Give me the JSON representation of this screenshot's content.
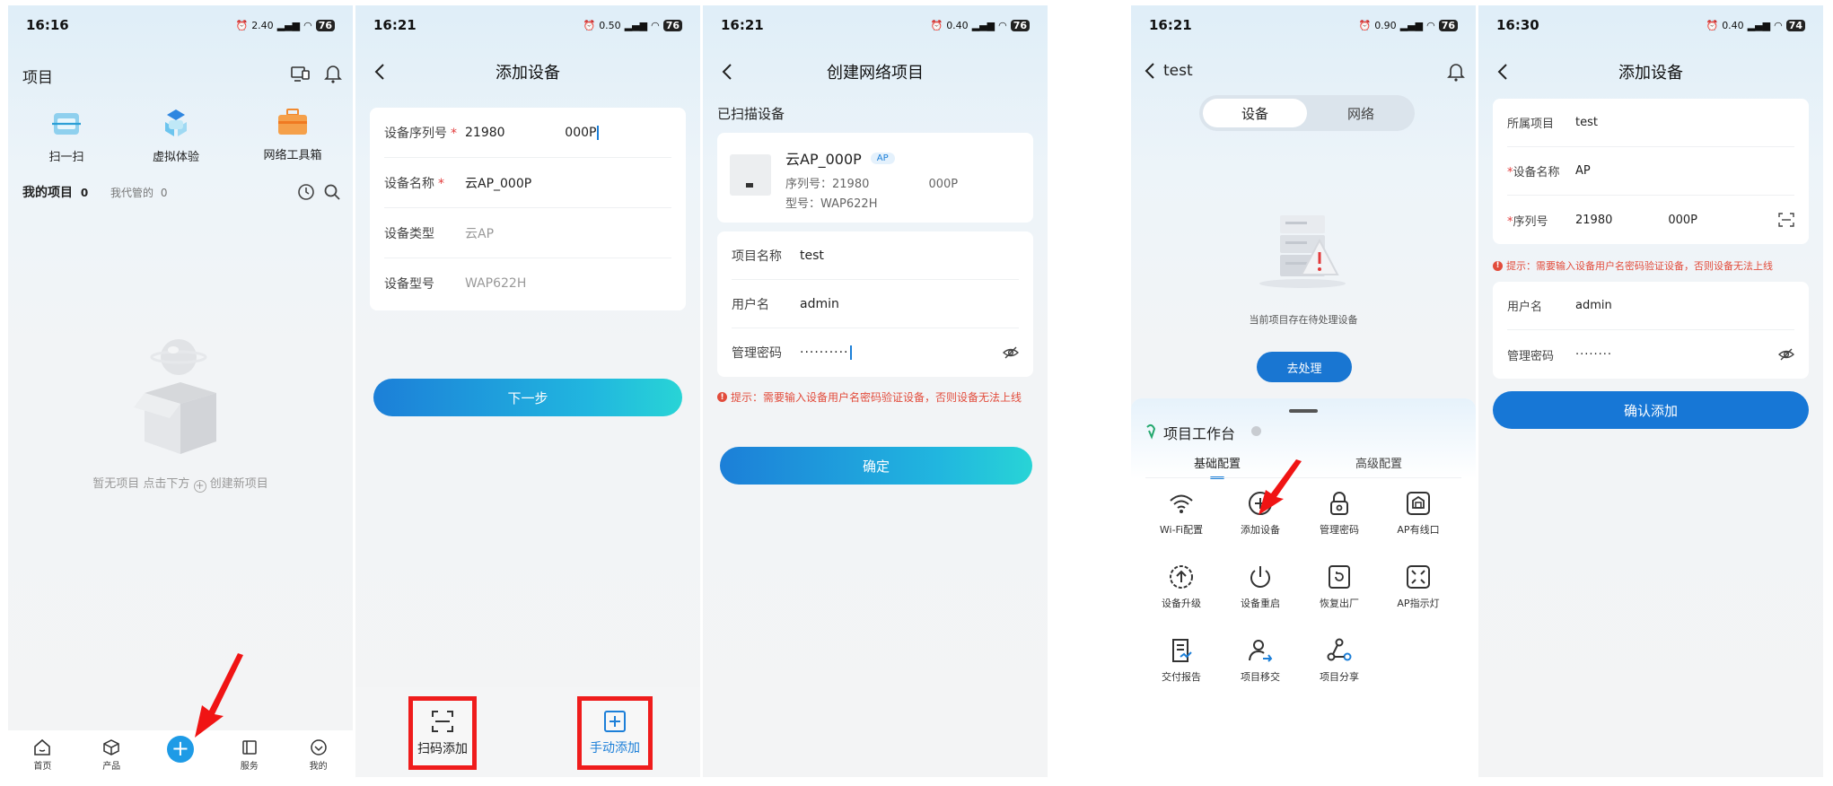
{
  "accent": "#1c7fd8",
  "warning_color": "#e24c3c",
  "screen1": {
    "time": "16:16",
    "net": "2.40",
    "battery": "76",
    "title": "项目",
    "quick_actions": [
      {
        "label": "扫一扫",
        "icon": "scan-icon"
      },
      {
        "label": "虚拟体验",
        "icon": "virtual-experience-icon"
      },
      {
        "label": "网络工具箱",
        "icon": "toolbox-icon"
      }
    ],
    "my_projects_label": "我的项目",
    "my_projects_count": "0",
    "managed_label": "我代管的",
    "managed_count": "0",
    "empty_text_a": "暂无项目 点击下方",
    "empty_text_b": "创建新项目",
    "tabs": [
      "首页",
      "产品",
      "服务",
      "我的"
    ]
  },
  "screen2": {
    "time": "16:21",
    "net": "0.50",
    "battery": "76",
    "title": "添加设备",
    "rows": [
      {
        "label": "设备序列号",
        "required": "*",
        "value": "21980               000P"
      },
      {
        "label": "设备名称",
        "required": "*",
        "value": "云AP_000P"
      },
      {
        "label": "设备类型",
        "required": "",
        "value": "云AP"
      },
      {
        "label": "设备型号",
        "required": "",
        "value": "WAP622H"
      }
    ],
    "next_button": "下一步",
    "scan_add": "扫码添加",
    "manual_add": "手动添加"
  },
  "screen3": {
    "time": "16:21",
    "net": "0.40",
    "battery": "76",
    "title": "创建网络项目",
    "scanned_label": "已扫描设备",
    "device_name": "云AP_000P",
    "device_tag": "AP",
    "serial_label": "序列号：",
    "serial_value": "21980                000P",
    "model_label": "型号：",
    "model_value": "WAP622H",
    "rows": [
      {
        "label": "项目名称",
        "value": "test"
      },
      {
        "label": "用户名",
        "value": "admin"
      },
      {
        "label": "管理密码",
        "value": "··········"
      }
    ],
    "warning": "提示：需要输入设备用户名密码验证设备，否则设备无法上线",
    "confirm": "确定"
  },
  "screen4": {
    "time": "16:21",
    "net": "0.90",
    "battery": "76",
    "back_title": "test",
    "seg_device": "设备",
    "seg_network": "网络",
    "pending_text": "当前项目存在待处理设备",
    "process_button": "去处理",
    "workbench_title": "项目工作台",
    "tab_basic": "基础配置",
    "tab_advanced": "高级配置",
    "grid": [
      {
        "label": "Wi-Fi配置",
        "icon": "wifi-icon"
      },
      {
        "label": "添加设备",
        "icon": "add-device-icon"
      },
      {
        "label": "管理密码",
        "icon": "lock-icon"
      },
      {
        "label": "AP有线口",
        "icon": "ap-port-icon"
      },
      {
        "label": "设备升级",
        "icon": "upgrade-icon"
      },
      {
        "label": "设备重启",
        "icon": "power-icon"
      },
      {
        "label": "恢复出厂",
        "icon": "reset-icon"
      },
      {
        "label": "AP指示灯",
        "icon": "ap-light-icon"
      },
      {
        "label": "交付报告",
        "icon": "report-icon"
      },
      {
        "label": "项目移交",
        "icon": "transfer-icon"
      },
      {
        "label": "项目分享",
        "icon": "share-icon"
      }
    ]
  },
  "screen5": {
    "time": "16:30",
    "net": "0.40",
    "battery": "74",
    "title": "添加设备",
    "rows": [
      {
        "label": "所属项目",
        "required": "",
        "value": "test"
      },
      {
        "label": "设备名称",
        "required": "*",
        "value": "AP"
      },
      {
        "label": "序列号",
        "required": "*",
        "value": "21980               000P"
      }
    ],
    "warning": "提示：需要输入设备用户名密码验证设备，否则设备无法上线",
    "cred_rows": [
      {
        "label": "用户名",
        "value": "admin"
      },
      {
        "label": "管理密码",
        "value": "········"
      }
    ],
    "confirm": "确认添加"
  }
}
